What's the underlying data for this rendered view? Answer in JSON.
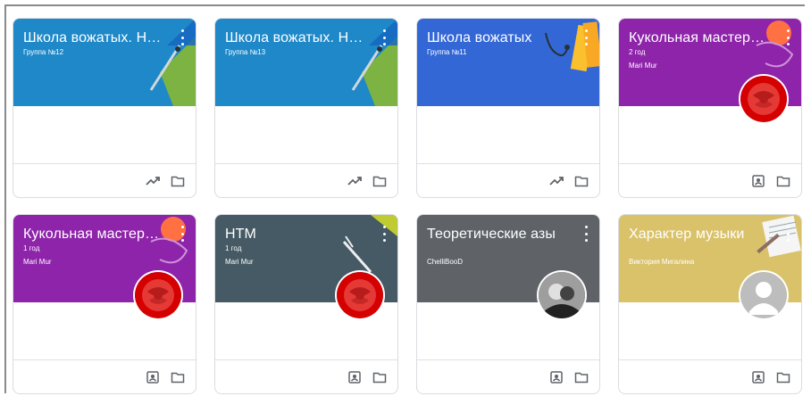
{
  "colors": {
    "blue": "#1e88c8",
    "royal_blue": "#3367d6",
    "purple": "#8e24aa",
    "slate": "#455a64",
    "dark_gray": "#5f6368",
    "mustard": "#d9c26a",
    "icon_gray": "#5f6368"
  },
  "classes": [
    {
      "title": "Школа вожатых. Нов...",
      "subtitle": "Группа №12",
      "owner": "",
      "color": "blue",
      "art": "geometry",
      "avatar": "none",
      "footer": [
        "trend-icon",
        "folder-icon"
      ]
    },
    {
      "title": "Школа вожатых. Нов...",
      "subtitle": "Группа №13",
      "owner": "",
      "color": "blue",
      "art": "geometry",
      "avatar": "none",
      "footer": [
        "trend-icon",
        "folder-icon"
      ]
    },
    {
      "title": "Школа вожатых",
      "subtitle": "Группа №11",
      "owner": "",
      "color": "royal_blue",
      "art": "books",
      "avatar": "none",
      "footer": [
        "trend-icon",
        "folder-icon"
      ]
    },
    {
      "title": "Кукольная мастерск...",
      "subtitle": "2 год",
      "owner": "Mari Mur",
      "color": "purple",
      "art": "yarn",
      "avatar": "rose",
      "footer": [
        "assignment-icon",
        "folder-icon"
      ]
    },
    {
      "title": "Кукольная мастерск...",
      "subtitle": "1 год",
      "owner": "Mari Mur",
      "color": "purple",
      "art": "yarn",
      "avatar": "rose",
      "footer": [
        "assignment-icon",
        "folder-icon"
      ]
    },
    {
      "title": "НТМ",
      "subtitle": "1 год",
      "owner": "Mari Mur",
      "color": "slate",
      "art": "compass",
      "avatar": "rose",
      "footer": [
        "assignment-icon",
        "folder-icon"
      ]
    },
    {
      "title": "Теоретические азы",
      "subtitle": "",
      "owner": "ChelliBooD",
      "color": "dark_gray",
      "art": "none",
      "avatar": "photo",
      "footer": [
        "assignment-icon",
        "folder-icon"
      ]
    },
    {
      "title": "Характер музыки",
      "subtitle": "",
      "owner": "Виктория Мигалина",
      "color": "mustard",
      "art": "sheet-music",
      "avatar": "default-person",
      "footer": [
        "assignment-icon",
        "folder-icon"
      ]
    }
  ]
}
